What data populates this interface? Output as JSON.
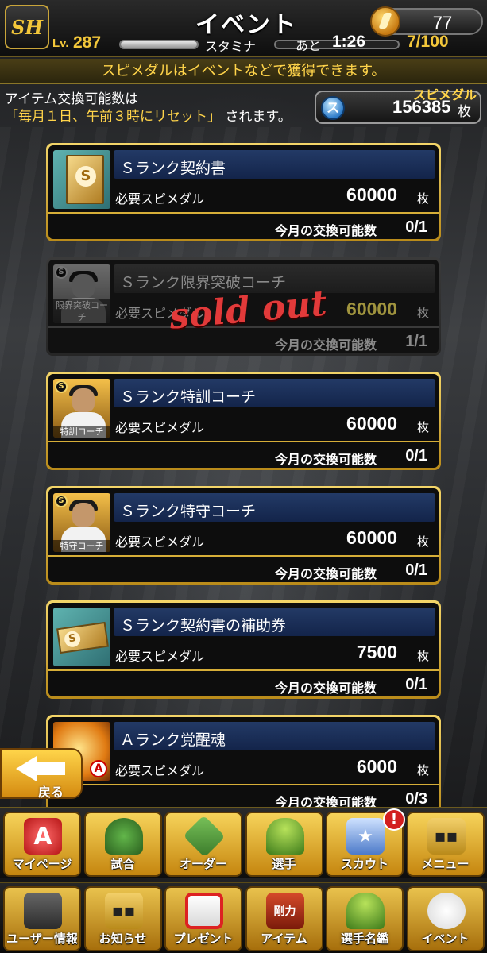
{
  "header": {
    "logo_text": "SH",
    "title": "イベント",
    "coins": "77",
    "lv_label": "Lv.",
    "level": "287",
    "level_progress": 1.0,
    "stamina_label": "スタミナ",
    "stamina_time_label": "あと",
    "stamina_time": "1:26",
    "stamina_count": "7/100"
  },
  "banner": "スピメダルはイベントなどで獲得できます。",
  "exchange_info": {
    "line1": "アイテム交換可能数は",
    "line2_highlight": "「毎月１日、午前３時にリセット」",
    "line2_rest": "されます。"
  },
  "medal": {
    "label": "スピメダル",
    "icon_char": "ス",
    "value": "156385",
    "unit": "枚"
  },
  "items": [
    {
      "name": "Ｓランク契約書",
      "req_label": "必要スピメダル",
      "cost": "60000",
      "unit": "枚",
      "limit_label": "今月の交換可能数",
      "limit": "0/1",
      "thumb_label": "",
      "sold_out": false
    },
    {
      "name": "Ｓランク限界突破コーチ",
      "req_label": "必要スピメダル",
      "cost": "60000",
      "unit": "枚",
      "limit_label": "今月の交換可能数",
      "limit": "1/1",
      "thumb_label": "限界突破コーチ",
      "sold_out": true,
      "sold_out_text": "sold out"
    },
    {
      "name": "Ｓランク特訓コーチ",
      "req_label": "必要スピメダル",
      "cost": "60000",
      "unit": "枚",
      "limit_label": "今月の交換可能数",
      "limit": "0/1",
      "thumb_label": "特訓コーチ",
      "sold_out": false
    },
    {
      "name": "Ｓランク特守コーチ",
      "req_label": "必要スピメダル",
      "cost": "60000",
      "unit": "枚",
      "limit_label": "今月の交換可能数",
      "limit": "0/1",
      "thumb_label": "特守コーチ",
      "sold_out": false
    },
    {
      "name": "Ｓランク契約書の補助券",
      "req_label": "必要スピメダル",
      "cost": "7500",
      "unit": "枚",
      "limit_label": "今月の交換可能数",
      "limit": "0/1",
      "thumb_label": "",
      "sold_out": false
    },
    {
      "name": "Ａランク覚醒魂",
      "req_label": "必要スピメダル",
      "cost": "6000",
      "unit": "枚",
      "limit_label": "今月の交換可能数",
      "limit": "0/3",
      "thumb_label": "",
      "sold_out": false
    }
  ],
  "back_label": "戻る",
  "nav_top": [
    {
      "label": "マイページ",
      "icon": "a-logo-icon",
      "glyph": "A"
    },
    {
      "label": "試合",
      "icon": "stadium-icon",
      "glyph": ""
    },
    {
      "label": "オーダー",
      "icon": "diamond-field-icon",
      "glyph": ""
    },
    {
      "label": "選手",
      "icon": "player-icon",
      "glyph": ""
    },
    {
      "label": "スカウト",
      "icon": "scout-card-icon",
      "glyph": "★",
      "badge": "!"
    },
    {
      "label": "メニュー",
      "icon": "menu-box-icon",
      "glyph": "▪▪"
    }
  ],
  "nav_bottom": [
    {
      "label": "ユーザー情報",
      "icon": "user-info-icon",
      "glyph": ""
    },
    {
      "label": "お知らせ",
      "icon": "notice-icon",
      "glyph": "▪▪"
    },
    {
      "label": "プレゼント",
      "icon": "gift-icon",
      "glyph": ""
    },
    {
      "label": "アイテム",
      "icon": "item-book-icon",
      "glyph": "剛力"
    },
    {
      "label": "選手名鑑",
      "icon": "player-book-icon",
      "glyph": ""
    },
    {
      "label": "イベント",
      "icon": "event-ball-icon",
      "glyph": ""
    }
  ],
  "colors": {
    "accent_gold": "#f3c73a",
    "sold_out_red": "#e23a3a",
    "name_bar_blue": "#233a66"
  }
}
